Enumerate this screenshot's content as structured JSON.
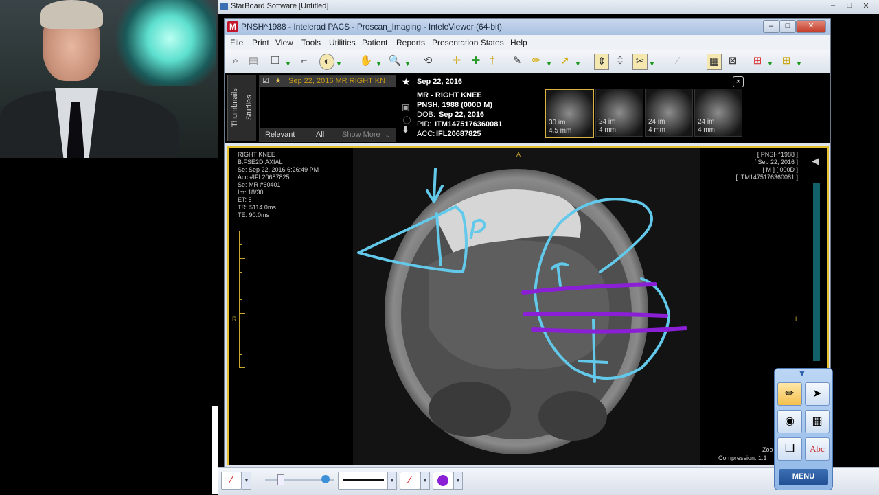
{
  "starboard": {
    "title": "StarBoard Software [Untitled]",
    "menu_label": "MENU"
  },
  "intelerad": {
    "title": "PNSH^1988 - Intelerad PACS - Proscan_Imaging - InteleViewer (64-bit)",
    "logo": "M",
    "menus": [
      "File",
      "Print",
      "View",
      "Tools",
      "Utilities",
      "Patient",
      "Reports",
      "Presentation States",
      "Help"
    ]
  },
  "studies_panel": {
    "tabs": [
      "Thumbnails",
      "Studies"
    ],
    "study_row": "Sep 22, 2016  MR  RIGHT KN",
    "filters": [
      "Relevant",
      "All",
      "Show More"
    ],
    "close": "×"
  },
  "patient": {
    "date": "Sep 22, 2016",
    "study": "MR - RIGHT KNEE",
    "name": "PNSH, 1988 (000D M)",
    "dob_label": "DOB:",
    "dob": "Sep 22, 2016",
    "pid_label": "PID:",
    "pid": "ITM1475176360081",
    "acc_label": "ACC:",
    "acc": "IFL20687825"
  },
  "thumbnails": [
    {
      "count": "30 im",
      "size": "4.5 mm"
    },
    {
      "count": "24 im",
      "size": "4 mm"
    },
    {
      "count": "24 im",
      "size": "4 mm"
    },
    {
      "count": "24 im",
      "size": "4 mm"
    }
  ],
  "overlay": {
    "left": [
      "RIGHT KNEE",
      "B:FSE2D:AXIAL",
      "Se: Sep 22, 2016 6:26:49 PM",
      "Acc #IFL20687825",
      "Se: MR #60401",
      "Im: 18/30",
      "ET: 5",
      "TR: 5114.0ms",
      "TE: 90.0ms"
    ],
    "right": [
      "[ PNSH^1988 ]",
      "[ Sep 22, 2016 ]",
      "[ M ] [ 000D ]",
      "[ ITM1475176360081 ]"
    ],
    "orient_top": "A",
    "orient_left": "R",
    "orient_right": "L",
    "zoom": "Zoo",
    "compression": "Compression: 1:1"
  },
  "colors": {
    "annotation_blue": "#63c9ea",
    "annotation_purple": "#8a1fd6",
    "viewport_border": "#e3c02e",
    "thumb_selected": "#d9b540"
  },
  "icons": {
    "toolbar": [
      "search-icon",
      "page-icon",
      "layers-icon",
      "brush-icon",
      "contrast-icon",
      "hand-icon",
      "zoom-icon",
      "rotate-icon",
      "crosshair-icon",
      "pin-icon",
      "pin-icon",
      "annotate-icon",
      "pencil-icon",
      "arrow-icon",
      "fit-icon",
      "flip-icon",
      "clip-icon",
      "scissors-icon",
      "window-icon",
      "grid-icon",
      "layout-icon"
    ],
    "palette": [
      "pen-icon",
      "cursor-icon",
      "mouse-icon",
      "grid-icon",
      "pages-icon",
      "text-icon"
    ]
  }
}
